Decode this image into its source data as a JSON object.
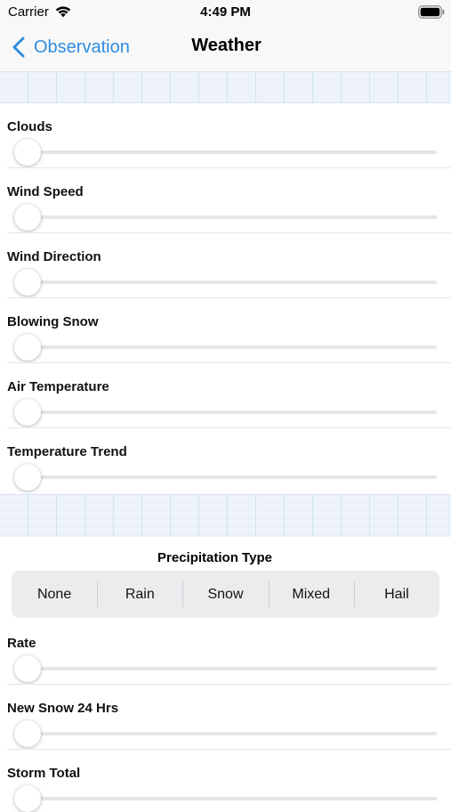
{
  "status_bar": {
    "carrier": "Carrier",
    "time": "4:49 PM",
    "icons": [
      "wifi-icon",
      "battery-icon"
    ]
  },
  "nav": {
    "back_label": "Observation",
    "back_icon": "chevron-left-icon",
    "title": "Weather",
    "accent_color": "#2f8ce0"
  },
  "sliders": [
    {
      "label": "Clouds",
      "value": 0
    },
    {
      "label": "Wind Speed",
      "value": 0
    },
    {
      "label": "Wind Direction",
      "value": 0
    },
    {
      "label": "Blowing Snow",
      "value": 0
    },
    {
      "label": "Air Temperature",
      "value": 0
    },
    {
      "label": "Temperature Trend",
      "value": 0
    }
  ],
  "precipitation": {
    "title": "Precipitation Type",
    "options": [
      "None",
      "Rain",
      "Snow",
      "Mixed",
      "Hail"
    ]
  },
  "precip_sliders": [
    {
      "label": "Rate",
      "value": 0
    },
    {
      "label": "New Snow 24 Hrs",
      "value": 0
    },
    {
      "label": "Storm Total",
      "value": 0
    }
  ]
}
